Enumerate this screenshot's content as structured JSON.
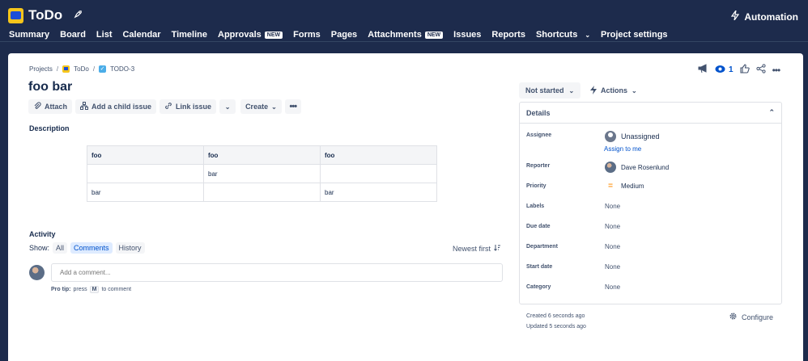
{
  "app": {
    "name": "ToDo",
    "automation_label": "Automation",
    "nav": [
      {
        "label": "Summary",
        "badge": ""
      },
      {
        "label": "Board",
        "badge": ""
      },
      {
        "label": "List",
        "badge": ""
      },
      {
        "label": "Calendar",
        "badge": ""
      },
      {
        "label": "Timeline",
        "badge": ""
      },
      {
        "label": "Approvals",
        "badge": "NEW"
      },
      {
        "label": "Forms",
        "badge": ""
      },
      {
        "label": "Pages",
        "badge": ""
      },
      {
        "label": "Attachments",
        "badge": "NEW"
      },
      {
        "label": "Issues",
        "badge": ""
      },
      {
        "label": "Reports",
        "badge": ""
      },
      {
        "label": "Shortcuts",
        "badge": ""
      },
      {
        "label": "Project settings",
        "badge": ""
      }
    ]
  },
  "breadcrumb": {
    "projects": "Projects",
    "project": "ToDo",
    "issue_key": "TODO-3",
    "sep": "/"
  },
  "issue": {
    "title": "foo bar",
    "toolbar": {
      "attach": "Attach",
      "add_child": "Add a child issue",
      "link": "Link issue",
      "create": "Create"
    },
    "description_label": "Description",
    "table": {
      "headers": [
        "foo",
        "foo",
        "foo"
      ],
      "rows": [
        [
          "",
          "bar",
          ""
        ],
        [
          "bar",
          "",
          "bar"
        ]
      ]
    },
    "activity": {
      "label": "Activity",
      "show_label": "Show:",
      "filters": [
        "All",
        "Comments",
        "History"
      ],
      "active_filter": "Comments",
      "sort": "Newest first",
      "comment_placeholder": "Add a comment...",
      "pro_tip_label": "Pro tip:",
      "pro_tip_press": "press",
      "pro_tip_key": "M",
      "pro_tip_suffix": "to comment"
    }
  },
  "sidebar": {
    "watch_count": "1",
    "status": "Not started",
    "actions": "Actions",
    "details_title": "Details",
    "fields": {
      "assignee_label": "Assignee",
      "assignee_value": "Unassigned",
      "assign_to_me": "Assign to me",
      "reporter_label": "Reporter",
      "reporter_value": "Dave Rosenlund",
      "priority_label": "Priority",
      "priority_value": "Medium",
      "labels_label": "Labels",
      "labels_value": "None",
      "due_label": "Due date",
      "due_value": "None",
      "department_label": "Department",
      "department_value": "None",
      "start_label": "Start date",
      "start_value": "None",
      "category_label": "Category",
      "category_value": "None"
    },
    "created": "Created 6 seconds ago",
    "updated": "Updated 5 seconds ago",
    "configure": "Configure"
  }
}
